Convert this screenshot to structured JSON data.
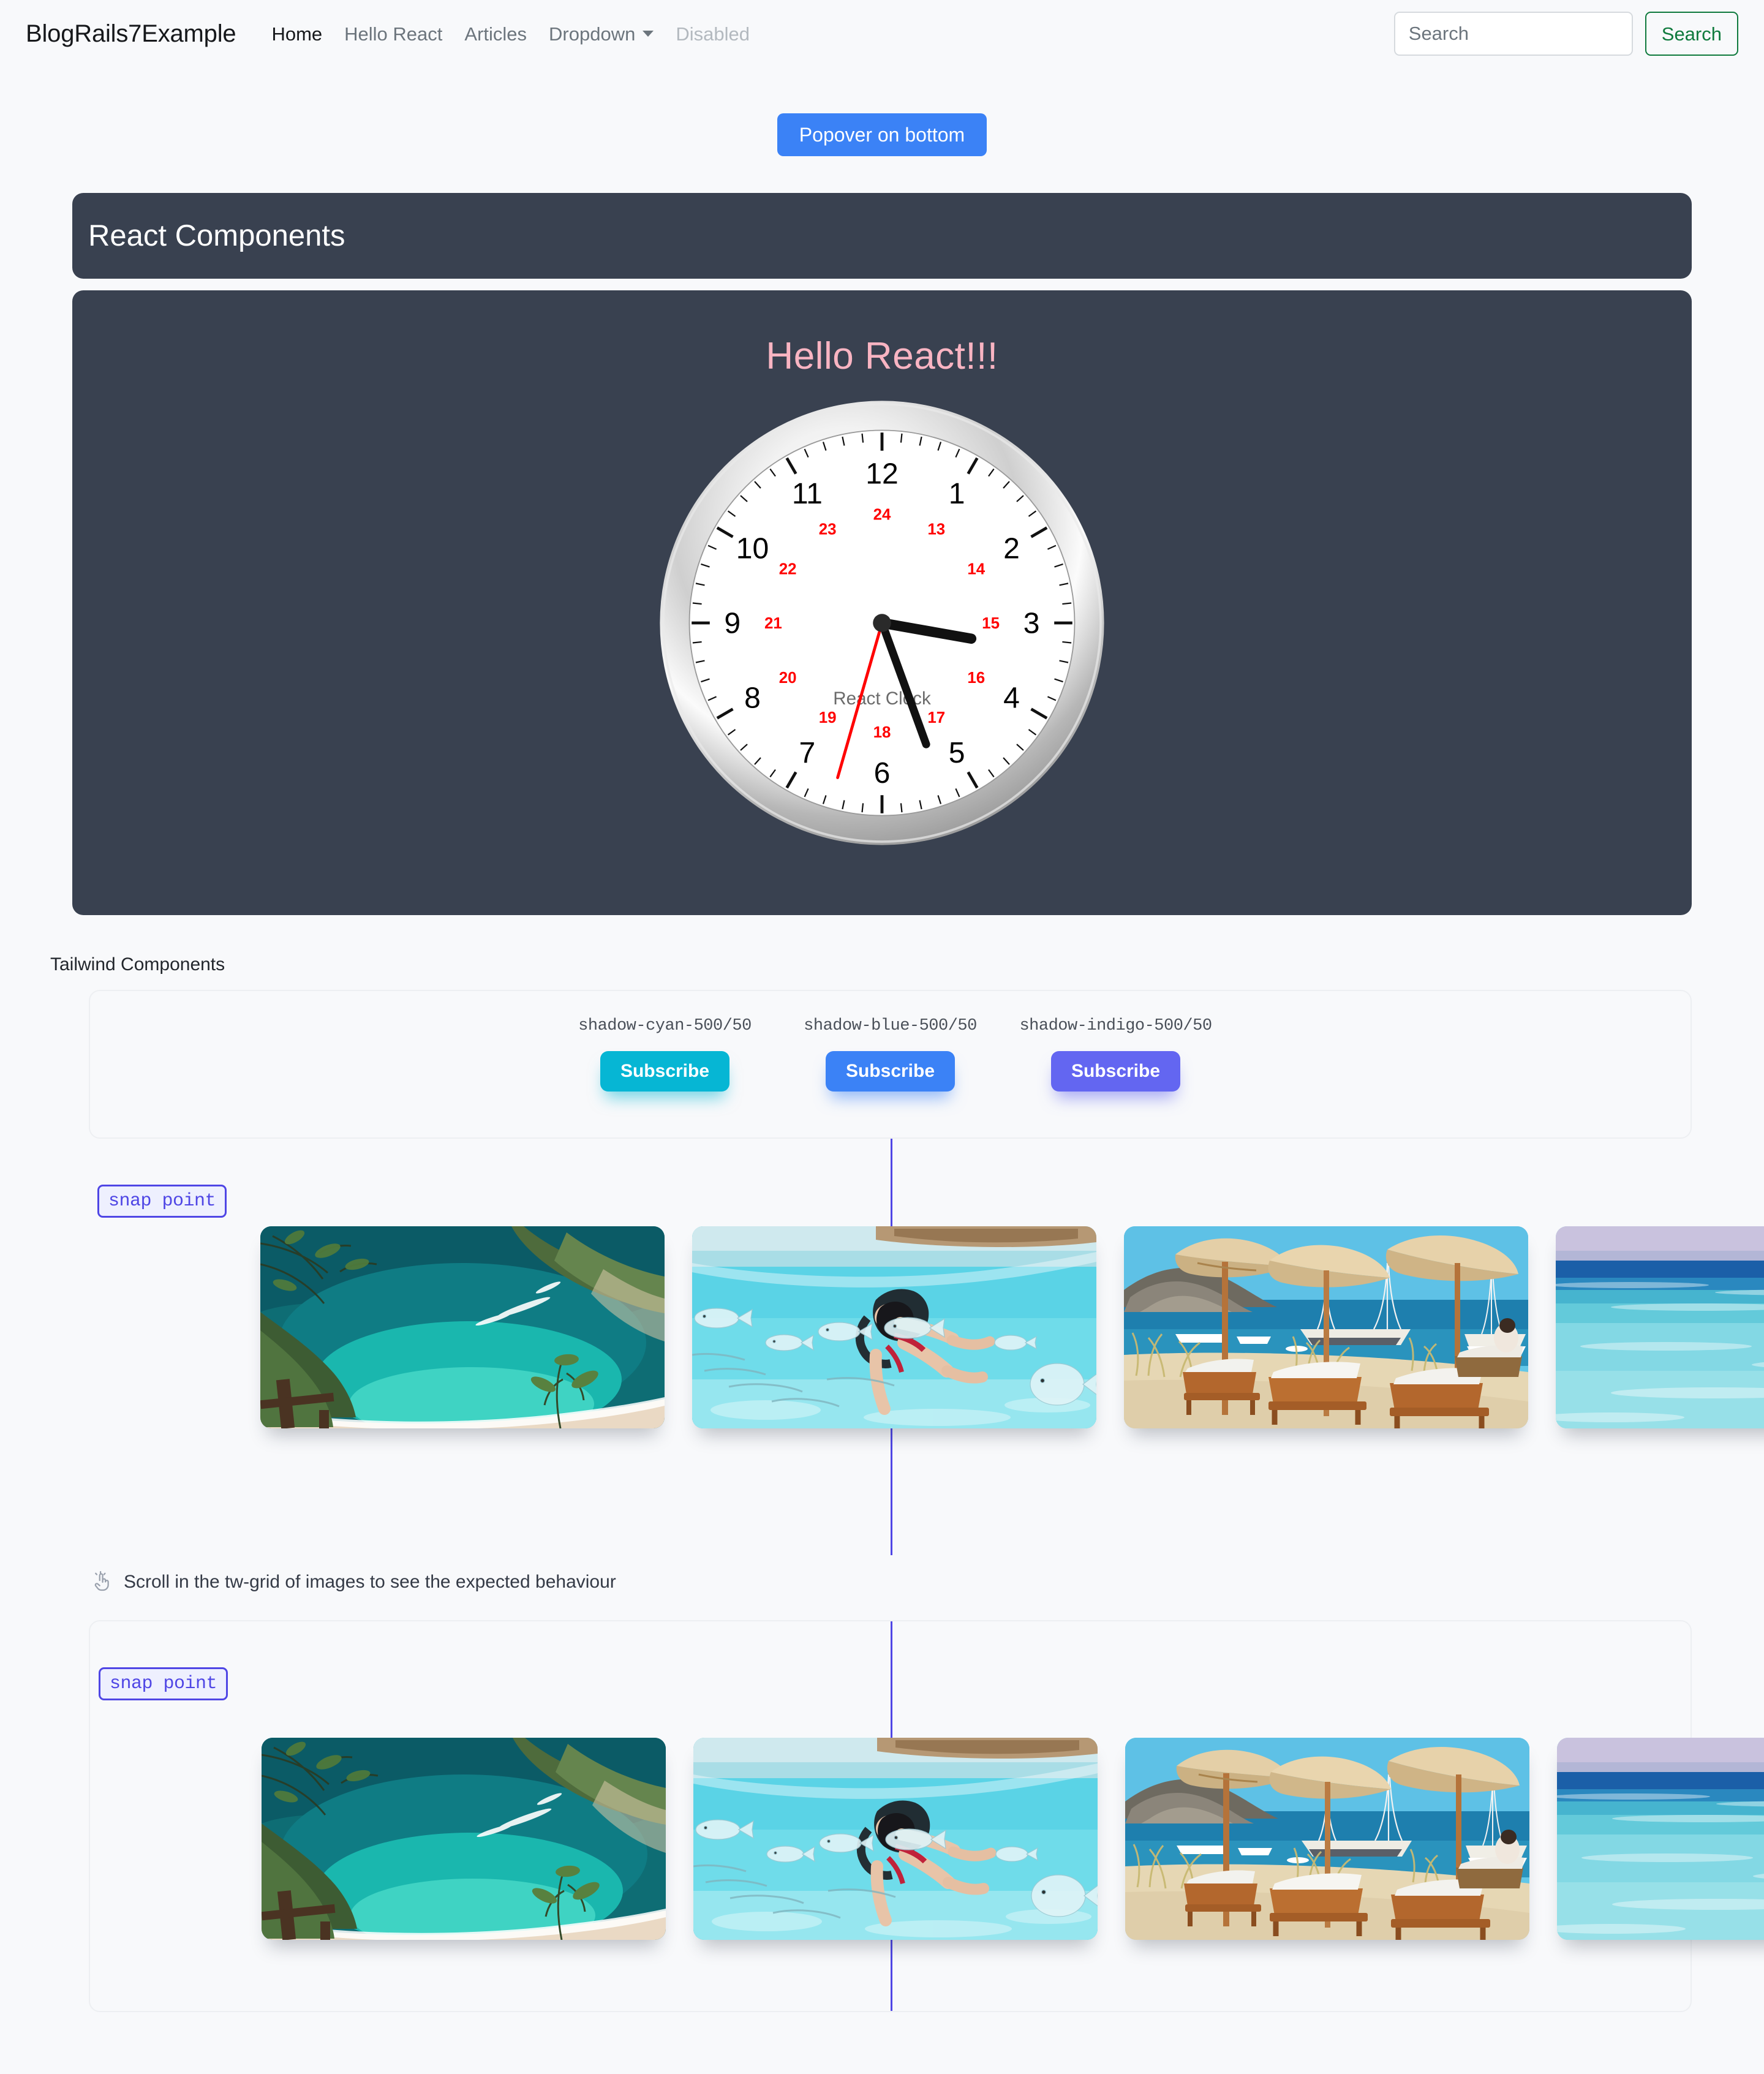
{
  "navbar": {
    "brand": "BlogRails7Example",
    "links": [
      {
        "label": "Home",
        "state": "active"
      },
      {
        "label": "Hello React",
        "state": "normal"
      },
      {
        "label": "Articles",
        "state": "normal"
      },
      {
        "label": "Dropdown",
        "state": "dropdown"
      },
      {
        "label": "Disabled",
        "state": "disabled"
      }
    ],
    "search": {
      "placeholder": "Search",
      "value": "",
      "button_label": "Search",
      "button_color": "#0f7a3d"
    }
  },
  "popover": {
    "button_label": "Popover on bottom",
    "color": "#3b82f6"
  },
  "react_panel": {
    "header_title": "React Components",
    "header_color": "#394150",
    "heading": "Hello React!!!",
    "heading_color": "#f9b4c2",
    "clock": {
      "face_label": "React Clock",
      "hour_numbers": [
        "12",
        "1",
        "2",
        "3",
        "4",
        "5",
        "6",
        "7",
        "8",
        "9",
        "10",
        "11"
      ],
      "inner_numbers": [
        "24",
        "13",
        "14",
        "15",
        "16",
        "17",
        "18",
        "19",
        "20",
        "21",
        "22",
        "23"
      ],
      "inner_number_color": "#ff0000",
      "hour_hand_deg": 100,
      "minute_hand_deg": 160,
      "second_hand_deg": 196,
      "second_hand_color": "#ff0000"
    }
  },
  "tailwind": {
    "section_label": "Tailwind Components",
    "subscribe_cards": [
      {
        "caption": "shadow-cyan-500/50",
        "button_label": "Subscribe",
        "color": "#06b6d4"
      },
      {
        "caption": "shadow-blue-500/50",
        "button_label": "Subscribe",
        "color": "#3b82f6"
      },
      {
        "caption": "shadow-indigo-500/50",
        "button_label": "Subscribe",
        "color": "#6366f1"
      }
    ],
    "carousels": [
      {
        "snap_badge": "snap point",
        "snapline_color": "#4f46e5",
        "images": [
          {
            "alt": "tropical-cliff-bay-aerial"
          },
          {
            "alt": "woman-swimming-underwater-with-fish"
          },
          {
            "alt": "beach-loungers-umbrellas-sailboats"
          },
          {
            "alt": "turquoise-sea-horizon"
          }
        ]
      },
      {
        "snap_badge": "snap point",
        "snapline_color": "#4f46e5",
        "images": [
          {
            "alt": "tropical-cliff-bay-aerial"
          },
          {
            "alt": "woman-swimming-underwater-with-fish"
          },
          {
            "alt": "beach-loungers-umbrellas-sailboats"
          },
          {
            "alt": "turquoise-sea-horizon"
          }
        ]
      }
    ],
    "hint": {
      "icon": "tap-hand-icon",
      "text": "Scroll in the tw-grid of images to see the expected behaviour"
    }
  }
}
